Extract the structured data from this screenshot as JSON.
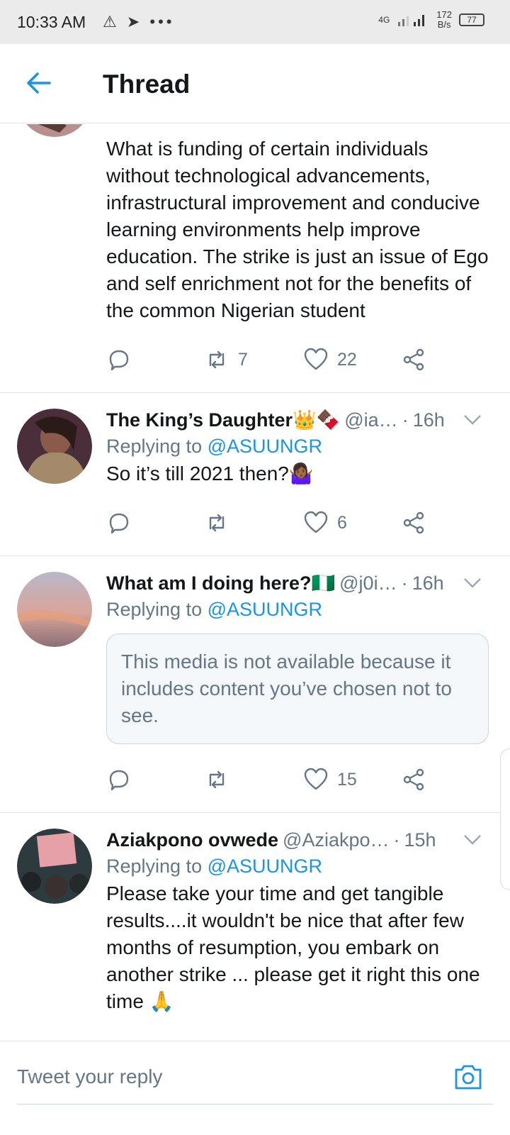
{
  "status_bar": {
    "time": "10:33 AM",
    "left_icons": "⚠ ➤ •••",
    "network": "4G",
    "speed": "172\nB/s",
    "speed_top": "172",
    "speed_bottom": "B/s",
    "battery": "77"
  },
  "header": {
    "title": "Thread"
  },
  "tweets": [
    {
      "text": "What is funding of certain individuals without technological advancements, infrastructural improvement and conducive learning environments help improve education. The strike is just an issue of Ego and self enrichment not for the benefits of the common Nigerian student",
      "retweets": "7",
      "likes": "22"
    },
    {
      "name": "The King’s Daughter👑🍫",
      "handle": "@ia…",
      "time": "16h",
      "replying_prefix": "Replying to",
      "replying_to": "@ASUUNGR",
      "text": "So it’s till 2021 then?🤷🏾‍♀️",
      "retweets": "",
      "likes": "6"
    },
    {
      "name": "What am I doing here?🇳🇬",
      "handle": "@j0i…",
      "time": "16h",
      "replying_prefix": "Replying to",
      "replying_to": "@ASUUNGR",
      "notice": "This media is not available because it includes content you’ve chosen not to see.",
      "retweets": "",
      "likes": "15"
    },
    {
      "name": "Aziakpono ovwede",
      "handle": "@Aziakpo…",
      "time": "15h",
      "replying_prefix": "Replying to",
      "replying_to": "@ASUUNGR",
      "text": "Please take your time and get tangible results....it wouldn't be nice that after few months of resumption, you embark on another strike ... please get it right this one time 🙏"
    }
  ],
  "compose": {
    "placeholder": "Tweet your reply"
  },
  "colors": {
    "accent": "#1b95e0",
    "muted": "#657786",
    "text": "#14171a"
  }
}
